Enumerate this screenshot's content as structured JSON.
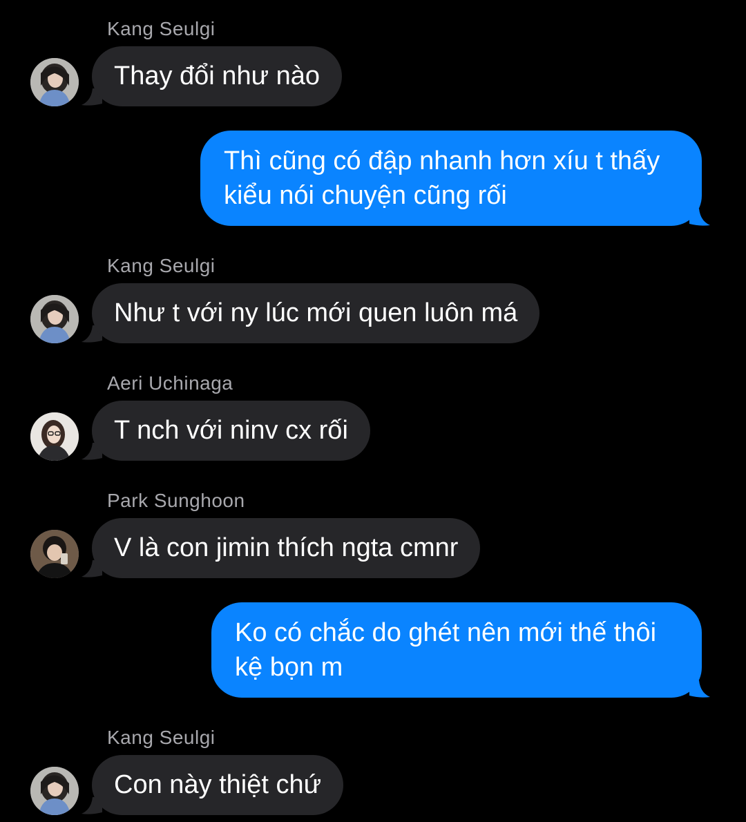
{
  "colors": {
    "background": "#000000",
    "incoming_bubble": "#262629",
    "outgoing_bubble": "#0a84ff",
    "sender_name": "#a8a8ad"
  },
  "messages": [
    {
      "direction": "incoming",
      "sender": "Kang Seulgi",
      "avatar": "kang-seulgi-avatar-icon",
      "text": "Thay đổi như nào"
    },
    {
      "direction": "outgoing",
      "text": "Thì cũng có đập nhanh hơn xíu t thấy kiểu nói chuyện cũng rối"
    },
    {
      "direction": "incoming",
      "sender": "Kang Seulgi",
      "avatar": "kang-seulgi-avatar-icon",
      "text": "Như t với ny lúc mới quen luôn má"
    },
    {
      "direction": "incoming",
      "sender": "Aeri Uchinaga",
      "avatar": "aeri-uchinaga-avatar-icon",
      "text": "T nch với ninv cx rối"
    },
    {
      "direction": "incoming",
      "sender": "Park Sunghoon",
      "avatar": "park-sunghoon-avatar-icon",
      "text": "V là con jimin thích ngta cmnr"
    },
    {
      "direction": "outgoing",
      "text": "Ko có chắc do ghét nên mới thế thôi kệ bọn m"
    },
    {
      "direction": "incoming",
      "sender": "Kang Seulgi",
      "avatar": "kang-seulgi-avatar-icon",
      "text": "Con này thiệt chứ"
    }
  ]
}
